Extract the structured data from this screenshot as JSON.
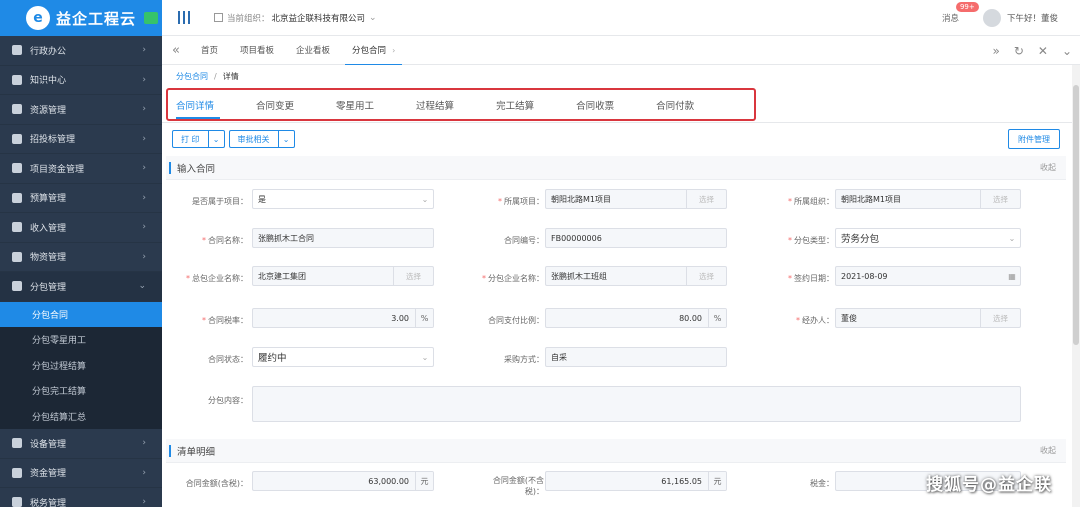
{
  "app": {
    "logo_glyph": "e",
    "logo_text": "益企工程云"
  },
  "sidebar": {
    "items_before": [
      {
        "label": "行政办公",
        "icon": "flag-icon"
      },
      {
        "label": "知识中心",
        "icon": "user-icon"
      },
      {
        "label": "资源管理",
        "icon": "folder-icon"
      },
      {
        "label": "招投标管理",
        "icon": "briefcase-icon"
      },
      {
        "label": "项目资金管理",
        "icon": "card-icon"
      },
      {
        "label": "预算管理",
        "icon": "calculator-icon"
      },
      {
        "label": "收入管理",
        "icon": "document-icon"
      },
      {
        "label": "物资管理",
        "icon": "box-icon"
      }
    ],
    "open_item": {
      "label": "分包管理",
      "icon": "layers-icon"
    },
    "sub_items": [
      "分包合同",
      "分包零星用工",
      "分包过程结算",
      "分包完工结算",
      "分包结算汇总"
    ],
    "items_after": [
      {
        "label": "设备管理",
        "icon": "device-icon"
      },
      {
        "label": "资金管理",
        "icon": "money-icon"
      },
      {
        "label": "税务管理",
        "icon": "tax-icon"
      }
    ]
  },
  "header": {
    "org_label": "当前组织：",
    "org_name": "北京益企联科技有限公司",
    "messages_label": "消息",
    "messages_badge": "99+",
    "greeting": "下午好！董俊"
  },
  "tabs": [
    {
      "label": "首页"
    },
    {
      "label": "项目看板"
    },
    {
      "label": "企业看板"
    },
    {
      "label": "分包合同"
    }
  ],
  "breadcrumb": {
    "parent": "分包合同",
    "separator": "/",
    "current": "详情"
  },
  "detail_tabs": [
    "合同详情",
    "合同变更",
    "零星用工",
    "过程结算",
    "完工结算",
    "合同收票",
    "合同付款"
  ],
  "toolbar": {
    "print": "打 印",
    "approval": "审批相关",
    "attachments": "附件管理"
  },
  "section1": {
    "title": "输入合同",
    "collapse": "收起",
    "fields": {
      "belongs_project": {
        "label": "是否属于项目：",
        "value": "是"
      },
      "project": {
        "label": "所属项目：",
        "value": "朝阳北路M1项目",
        "tag": "选择"
      },
      "org": {
        "label": "所属组织：",
        "value": "朝阳北路M1项目",
        "tag": "选择"
      },
      "contract_name": {
        "label": "合同名称：",
        "value": "张鹏抓木工合同"
      },
      "contract_no": {
        "label": "合同编号：",
        "value": "FB00000006"
      },
      "sub_type": {
        "label": "分包类型：",
        "value": "劳务分包"
      },
      "general_contractor": {
        "label": "总包企业名称：",
        "value": "北京建工集团",
        "tag": "选择"
      },
      "sub_contractor": {
        "label": "分包企业名称：",
        "value": "张鹏抓木工班组",
        "tag": "选择"
      },
      "sign_date": {
        "label": "签约日期：",
        "value": "2021-08-09"
      },
      "tax_rate": {
        "label": "合同税率：",
        "value": "3.00",
        "suffix": "%"
      },
      "pay_ratio": {
        "label": "合同支付比例：",
        "value": "80.00",
        "suffix": "%"
      },
      "handler": {
        "label": "经办人：",
        "value": "董俊",
        "tag": "选择"
      },
      "status": {
        "label": "合同状态：",
        "value": "履约中"
      },
      "purchase": {
        "label": "采购方式：",
        "value": "自采"
      },
      "content": {
        "label": "分包内容：",
        "value": ""
      }
    }
  },
  "section2": {
    "title": "清单明细",
    "collapse": "收起",
    "fields": {
      "amount_tax": {
        "label": "合同金额(含税)：",
        "value": "63,000.00",
        "suffix": "元"
      },
      "amount_notax_l1": "合同金额(不含",
      "amount_notax_l2": "税)：",
      "amount_notax": {
        "value": "61,165.05",
        "suffix": "元"
      },
      "tax": {
        "label": "税金："
      }
    }
  },
  "watermark": "搜狐号@益企联",
  "colors": {
    "primary": "#1f8ae6",
    "sidebar": "#2b3a4e",
    "highlight_border": "#d9363e"
  }
}
